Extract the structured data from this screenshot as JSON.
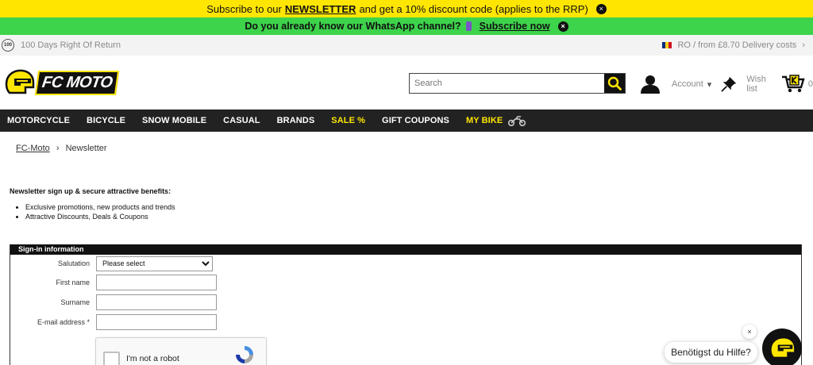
{
  "announcement": {
    "pre": "Subscribe to our",
    "link": "NEWSLETTER",
    "post": "and get a 10% discount code (applies to the RRP)"
  },
  "whatsapp": {
    "text": "Do you already know our WhatsApp channel?",
    "link": "Subscribe now"
  },
  "utility": {
    "badge": "100",
    "returns": "100 Days Right Of Return",
    "delivery": "RO / from £8.70 Delivery costs",
    "chevron": "›"
  },
  "header": {
    "logo_text": "FC MOTO",
    "search_placeholder": "Search",
    "account": "Account",
    "caret": "▾",
    "wishlist": "Wish list",
    "cart_count": "0"
  },
  "nav": {
    "items": [
      "MOTORCYCLE",
      "BICYCLE",
      "SNOW MOBILE",
      "CASUAL",
      "BRANDS",
      "SALE %",
      "GIFT COUPONS",
      "MY BIKE"
    ],
    "accent": "#ffe600"
  },
  "breadcrumb": {
    "home": "FC-Moto",
    "sep": "›",
    "current": "Newsletter"
  },
  "intro": {
    "heading": "Newsletter sign up & secure attractive benefits:",
    "bullets": [
      "Exclusive promotions, new products and trends",
      "Attractive Discounts, Deals & Coupons"
    ]
  },
  "form": {
    "title": "Sign-in information",
    "salutation_label": "Salutation",
    "salutation_value": "Please select",
    "firstname_label": "First name",
    "surname_label": "Surname",
    "email_label": "E-mail address *"
  },
  "captcha": {
    "label": "I'm not a robot"
  },
  "help": {
    "text": "Benötigst du Hilfe?",
    "close": "×"
  },
  "icons": {
    "close": "×"
  },
  "colors": {
    "brand_yellow": "#ffe600",
    "whatsapp_green": "#3dd34b",
    "nav_bg": "#222222"
  }
}
